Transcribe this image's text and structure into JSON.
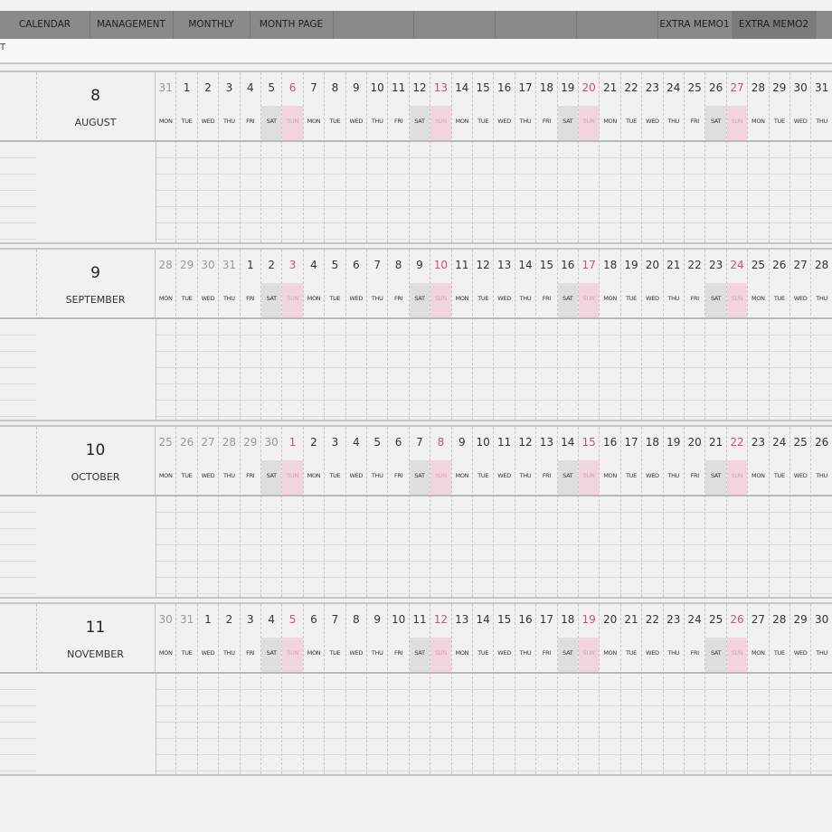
{
  "nav": {
    "tabs": [
      {
        "id": "calendar",
        "label": "CALENDAR",
        "active": false
      },
      {
        "id": "management",
        "label": "MANAGEMENT",
        "active": false
      },
      {
        "id": "monthly",
        "label": "MONTHLY",
        "active": false
      },
      {
        "id": "month-page",
        "label": "MONTH PAGE",
        "active": false
      },
      {
        "id": "extra-memo1",
        "label": "EXTRA MEMO1",
        "active": false
      },
      {
        "id": "extra-memo2",
        "label": "EXTRA MEMO2",
        "active": true
      }
    ]
  },
  "subbar": {
    "crumb": "T"
  },
  "colors": {
    "sun_text": "#d04d7a",
    "sun_bg": "#f2d4de",
    "sat_bg": "#dedede",
    "topbar": "#8a8a8a"
  },
  "months": [
    {
      "number": "8",
      "name": "AUGUST",
      "days": [
        {
          "n": "31",
          "d": "MON",
          "other": true
        },
        {
          "n": "1",
          "d": "TUE"
        },
        {
          "n": "2",
          "d": "WED"
        },
        {
          "n": "3",
          "d": "THU"
        },
        {
          "n": "4",
          "d": "FRI"
        },
        {
          "n": "5",
          "d": "SAT"
        },
        {
          "n": "6",
          "d": "SUN"
        },
        {
          "n": "7",
          "d": "MON"
        },
        {
          "n": "8",
          "d": "TUE"
        },
        {
          "n": "9",
          "d": "WED"
        },
        {
          "n": "10",
          "d": "THU"
        },
        {
          "n": "11",
          "d": "FRI"
        },
        {
          "n": "12",
          "d": "SAT"
        },
        {
          "n": "13",
          "d": "SUN"
        },
        {
          "n": "14",
          "d": "MON"
        },
        {
          "n": "15",
          "d": "TUE"
        },
        {
          "n": "16",
          "d": "WED"
        },
        {
          "n": "17",
          "d": "THU"
        },
        {
          "n": "18",
          "d": "FRI"
        },
        {
          "n": "19",
          "d": "SAT"
        },
        {
          "n": "20",
          "d": "SUN"
        },
        {
          "n": "21",
          "d": "MON"
        },
        {
          "n": "22",
          "d": "TUE"
        },
        {
          "n": "23",
          "d": "WED"
        },
        {
          "n": "24",
          "d": "THU"
        },
        {
          "n": "25",
          "d": "FRI"
        },
        {
          "n": "26",
          "d": "SAT"
        },
        {
          "n": "27",
          "d": "SUN"
        },
        {
          "n": "28",
          "d": "MON"
        },
        {
          "n": "29",
          "d": "TUE"
        },
        {
          "n": "30",
          "d": "WED"
        },
        {
          "n": "31",
          "d": "THU"
        }
      ]
    },
    {
      "number": "9",
      "name": "SEPTEMBER",
      "days": [
        {
          "n": "28",
          "d": "MON",
          "other": true
        },
        {
          "n": "29",
          "d": "TUE",
          "other": true
        },
        {
          "n": "30",
          "d": "WED",
          "other": true
        },
        {
          "n": "31",
          "d": "THU",
          "other": true
        },
        {
          "n": "1",
          "d": "FRI"
        },
        {
          "n": "2",
          "d": "SAT"
        },
        {
          "n": "3",
          "d": "SUN"
        },
        {
          "n": "4",
          "d": "MON"
        },
        {
          "n": "5",
          "d": "TUE"
        },
        {
          "n": "6",
          "d": "WED"
        },
        {
          "n": "7",
          "d": "THU"
        },
        {
          "n": "8",
          "d": "FRI"
        },
        {
          "n": "9",
          "d": "SAT"
        },
        {
          "n": "10",
          "d": "SUN"
        },
        {
          "n": "11",
          "d": "MON"
        },
        {
          "n": "12",
          "d": "TUE"
        },
        {
          "n": "13",
          "d": "WED"
        },
        {
          "n": "14",
          "d": "THU"
        },
        {
          "n": "15",
          "d": "FRI"
        },
        {
          "n": "16",
          "d": "SAT"
        },
        {
          "n": "17",
          "d": "SUN"
        },
        {
          "n": "18",
          "d": "MON"
        },
        {
          "n": "19",
          "d": "TUE"
        },
        {
          "n": "20",
          "d": "WED"
        },
        {
          "n": "21",
          "d": "THU"
        },
        {
          "n": "22",
          "d": "FRI"
        },
        {
          "n": "23",
          "d": "SAT"
        },
        {
          "n": "24",
          "d": "SUN"
        },
        {
          "n": "25",
          "d": "MON"
        },
        {
          "n": "26",
          "d": "TUE"
        },
        {
          "n": "27",
          "d": "WED"
        },
        {
          "n": "28",
          "d": "THU"
        }
      ]
    },
    {
      "number": "10",
      "name": "OCTOBER",
      "days": [
        {
          "n": "25",
          "d": "MON",
          "other": true
        },
        {
          "n": "26",
          "d": "TUE",
          "other": true
        },
        {
          "n": "27",
          "d": "WED",
          "other": true
        },
        {
          "n": "28",
          "d": "THU",
          "other": true
        },
        {
          "n": "29",
          "d": "FRI",
          "other": true
        },
        {
          "n": "30",
          "d": "SAT",
          "other": true
        },
        {
          "n": "1",
          "d": "SUN"
        },
        {
          "n": "2",
          "d": "MON"
        },
        {
          "n": "3",
          "d": "TUE"
        },
        {
          "n": "4",
          "d": "WED"
        },
        {
          "n": "5",
          "d": "THU"
        },
        {
          "n": "6",
          "d": "FRI"
        },
        {
          "n": "7",
          "d": "SAT"
        },
        {
          "n": "8",
          "d": "SUN"
        },
        {
          "n": "9",
          "d": "MON"
        },
        {
          "n": "10",
          "d": "TUE"
        },
        {
          "n": "11",
          "d": "WED"
        },
        {
          "n": "12",
          "d": "THU"
        },
        {
          "n": "13",
          "d": "FRI"
        },
        {
          "n": "14",
          "d": "SAT"
        },
        {
          "n": "15",
          "d": "SUN"
        },
        {
          "n": "16",
          "d": "MON"
        },
        {
          "n": "17",
          "d": "TUE"
        },
        {
          "n": "18",
          "d": "WED"
        },
        {
          "n": "19",
          "d": "THU"
        },
        {
          "n": "20",
          "d": "FRI"
        },
        {
          "n": "21",
          "d": "SAT"
        },
        {
          "n": "22",
          "d": "SUN"
        },
        {
          "n": "23",
          "d": "MON"
        },
        {
          "n": "24",
          "d": "TUE"
        },
        {
          "n": "25",
          "d": "WED"
        },
        {
          "n": "26",
          "d": "THU"
        }
      ]
    },
    {
      "number": "11",
      "name": "NOVEMBER",
      "days": [
        {
          "n": "30",
          "d": "MON",
          "other": true
        },
        {
          "n": "31",
          "d": "TUE",
          "other": true
        },
        {
          "n": "1",
          "d": "WED"
        },
        {
          "n": "2",
          "d": "THU"
        },
        {
          "n": "3",
          "d": "FRI"
        },
        {
          "n": "4",
          "d": "SAT"
        },
        {
          "n": "5",
          "d": "SUN"
        },
        {
          "n": "6",
          "d": "MON"
        },
        {
          "n": "7",
          "d": "TUE"
        },
        {
          "n": "8",
          "d": "WED"
        },
        {
          "n": "9",
          "d": "THU"
        },
        {
          "n": "10",
          "d": "FRI"
        },
        {
          "n": "11",
          "d": "SAT"
        },
        {
          "n": "12",
          "d": "SUN"
        },
        {
          "n": "13",
          "d": "MON"
        },
        {
          "n": "14",
          "d": "TUE"
        },
        {
          "n": "15",
          "d": "WED"
        },
        {
          "n": "16",
          "d": "THU"
        },
        {
          "n": "17",
          "d": "FRI"
        },
        {
          "n": "18",
          "d": "SAT"
        },
        {
          "n": "19",
          "d": "SUN"
        },
        {
          "n": "20",
          "d": "MON"
        },
        {
          "n": "21",
          "d": "TUE"
        },
        {
          "n": "22",
          "d": "WED"
        },
        {
          "n": "23",
          "d": "THU"
        },
        {
          "n": "24",
          "d": "FRI"
        },
        {
          "n": "25",
          "d": "SAT"
        },
        {
          "n": "26",
          "d": "SUN"
        },
        {
          "n": "27",
          "d": "MON"
        },
        {
          "n": "28",
          "d": "TUE"
        },
        {
          "n": "29",
          "d": "WED"
        },
        {
          "n": "30",
          "d": "THU"
        }
      ]
    }
  ]
}
